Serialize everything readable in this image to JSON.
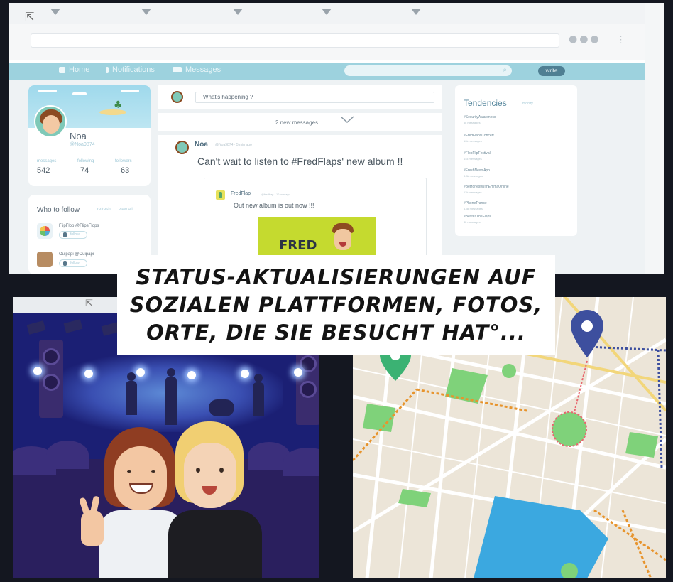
{
  "browser": {
    "menu_dots": "●●●",
    "kebab": "⋮",
    "cursor": "⇱"
  },
  "navbar": {
    "home": "Home",
    "notifications": "Notifications",
    "messages": "Messages",
    "search_icon": "⌕",
    "write_button": "write"
  },
  "profile": {
    "name": "Noa",
    "handle": "@Noa9874",
    "stats": [
      {
        "label": "messages",
        "value": "542"
      },
      {
        "label": "following",
        "value": "74"
      },
      {
        "label": "followers",
        "value": "63"
      }
    ]
  },
  "who_to_follow": {
    "title": "Who to follow",
    "refresh": "refresh",
    "view_all": "view all",
    "people": [
      {
        "name": "FlipFlop   @FlipsFlops",
        "button": "follow",
        "color": "#e9f2f6"
      },
      {
        "name": "Ouipapi   @Ouipapi",
        "button": "follow",
        "color": "#b78c62"
      }
    ]
  },
  "feed": {
    "compose_placeholder": "What's happening ?",
    "new_messages": "2 new messages",
    "post": {
      "author": "Noa",
      "meta": "@Noa9874 · 5 min ago",
      "text": "Can't wait to listen to #FredFlaps' new album !!",
      "quote": {
        "author": "FredFlap",
        "meta": "@fredflap · 10 min ago",
        "text": "Out new album is out now !!!",
        "album_title": "FRED"
      }
    }
  },
  "tendencies": {
    "title": "Tendencies",
    "modify": "modify",
    "items": [
      {
        "tag": "#SecurityAwareness",
        "count": "5k messages"
      },
      {
        "tag": "#FredFlapsConcert",
        "count": "10k messages"
      },
      {
        "tag": "#FlopFlipFestival",
        "count": "14k messages"
      },
      {
        "tag": "#FreshNewsApp",
        "count": "3.5k messages"
      },
      {
        "tag": "#BeHonestWithEmmaOnline",
        "count": "12k messages"
      },
      {
        "tag": "#PhoneTrance",
        "count": "4.5k messages"
      },
      {
        "tag": "#BestOfTheFlaps",
        "count": "3k messages"
      }
    ]
  },
  "concert": {
    "cursor": "⇱"
  },
  "caption": {
    "lines": [
      "STATUS-AKTUALISIERUNGEN AUF",
      "SOZIALEN PLATTFORMEN, FOTOS,",
      "ORTE, DIE SIE BESUCHT HAT°..."
    ]
  },
  "colors": {
    "navbar": "#9dd2de",
    "write_button": "#4f7f93",
    "map_park": "#7fd27a",
    "map_water": "#3ba8e0",
    "pin_green": "#3bb273",
    "pin_blue": "#3d4f9e"
  }
}
